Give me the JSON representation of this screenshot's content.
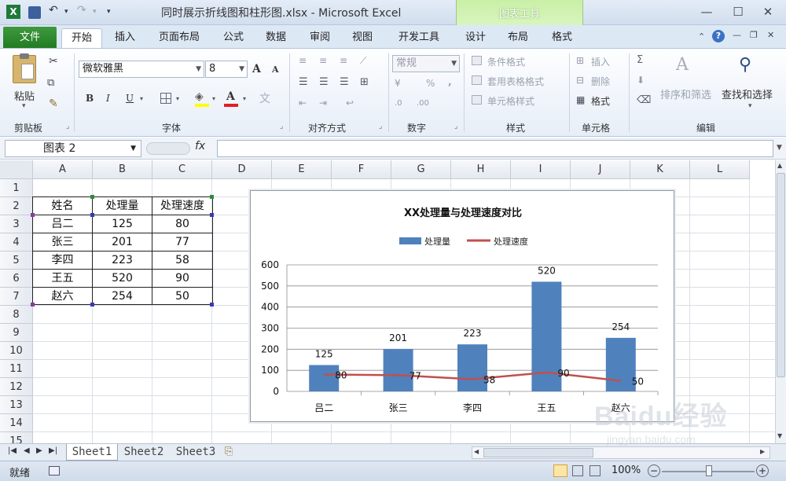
{
  "titlebar": {
    "document_title": "同时展示折线图和柱形图.xlsx - Microsoft Excel",
    "contextual_tab_group": "图表工具"
  },
  "tabs": [
    "文件",
    "开始",
    "插入",
    "页面布局",
    "公式",
    "数据",
    "审阅",
    "视图",
    "开发工具",
    "设计",
    "布局",
    "格式"
  ],
  "ribbon": {
    "clipboard": {
      "paste": "粘贴",
      "label": "剪贴板"
    },
    "font": {
      "name": "微软雅黑",
      "size": "8",
      "label": "字体",
      "bold": "B",
      "italic": "I",
      "underline": "U",
      "grow": "A",
      "shrink": "A",
      "font_color": "A"
    },
    "alignment": {
      "label": "对齐方式"
    },
    "number": {
      "format": "常规",
      "percent": "%",
      "comma": ",",
      "label": "数字"
    },
    "styles": {
      "conditional": "条件格式",
      "table": "套用表格格式",
      "cell_styles": "单元格样式",
      "label": "样式"
    },
    "cells": {
      "insert": "插入",
      "delete": "删除",
      "format": "格式",
      "label": "单元格"
    },
    "editing": {
      "sort": "排序和筛选",
      "find": "查找和选择",
      "label": "编辑",
      "sum": "Σ"
    }
  },
  "formula_bar": {
    "name_box": "图表 2",
    "fx": "fx"
  },
  "columns": [
    "A",
    "B",
    "C",
    "D",
    "E",
    "F",
    "G",
    "H",
    "I",
    "J",
    "K",
    "L"
  ],
  "rows": [
    "1",
    "2",
    "3",
    "4",
    "5",
    "6",
    "7",
    "8",
    "9",
    "10",
    "11",
    "12",
    "13",
    "14",
    "15"
  ],
  "table": {
    "headers": [
      "姓名",
      "处理量",
      "处理速度"
    ],
    "rows": [
      [
        "吕二",
        "125",
        "80"
      ],
      [
        "张三",
        "201",
        "77"
      ],
      [
        "李四",
        "223",
        "58"
      ],
      [
        "王五",
        "520",
        "90"
      ],
      [
        "赵六",
        "254",
        "50"
      ]
    ]
  },
  "chart_data": {
    "type": "bar",
    "title": "XX处理量与处理速度对比",
    "categories": [
      "吕二",
      "张三",
      "李四",
      "王五",
      "赵六"
    ],
    "series": [
      {
        "name": "处理量",
        "type": "bar",
        "values": [
          125,
          201,
          223,
          520,
          254
        ],
        "color": "#4f81bd"
      },
      {
        "name": "处理速度",
        "type": "line",
        "values": [
          80,
          77,
          58,
          90,
          50
        ],
        "color": "#c0504d"
      }
    ],
    "yticks": [
      "0",
      "100",
      "200",
      "300",
      "400",
      "500",
      "600"
    ],
    "ylim": [
      0,
      600
    ],
    "grid": true,
    "legend": "top"
  },
  "sheets": [
    "Sheet1",
    "Sheet2",
    "Sheet3"
  ],
  "status": {
    "ready": "就绪",
    "zoom": "100%"
  },
  "watermark": {
    "brand": "Baidu经验",
    "url": "jingyan.baidu.com"
  }
}
